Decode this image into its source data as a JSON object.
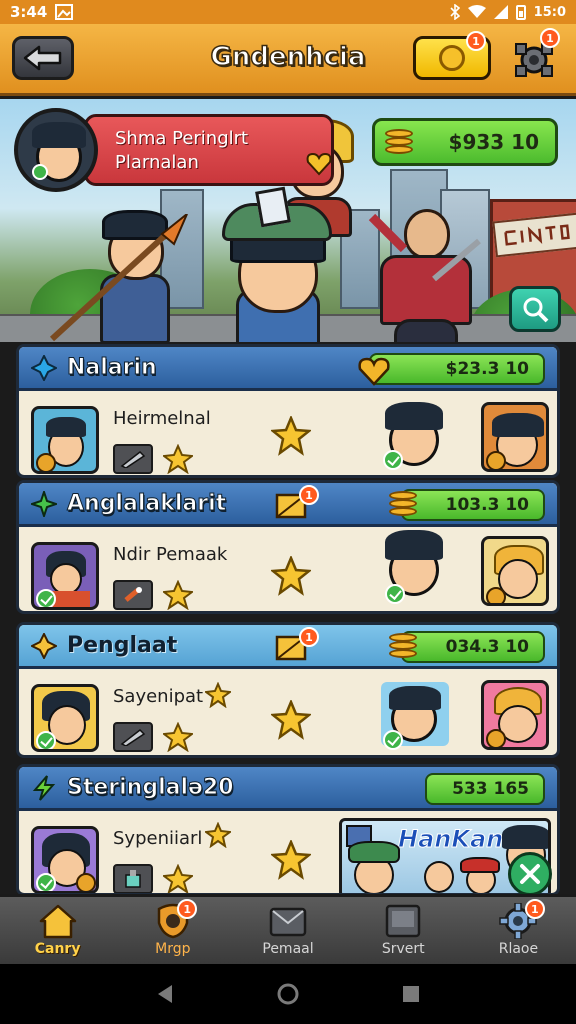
{
  "status_bar": {
    "time": "3:44",
    "right_text": "15:0"
  },
  "header": {
    "title": "Gndenhcia",
    "coin_badge": "1",
    "settings_badge": "1"
  },
  "profile": {
    "line1": "Shma Peringlrt",
    "line2": "Plarnalan"
  },
  "wallet": {
    "amount": "$933 10"
  },
  "sections": [
    {
      "title": "Nalarin",
      "amount": "$23.3 10",
      "row_name": "Heirmelnal"
    },
    {
      "title": "Anglalaklarit",
      "amount": "103.3 10",
      "row_name": "Ndir Pemaak",
      "notice_badge": "1"
    },
    {
      "title": "Penglaat",
      "amount": "034.3 10",
      "row_name": "Sayenipat",
      "notice_badge": "1"
    },
    {
      "title": "Steringlalə20",
      "amount": "533 165",
      "row_name": "Sypeniiarl",
      "promo_label": "HanKan"
    }
  ],
  "bottom_nav": [
    {
      "label": "Canry",
      "icon": "house-icon"
    },
    {
      "label": "Mrgp",
      "icon": "shield-badge-icon",
      "badge": "1"
    },
    {
      "label": "Pemaal",
      "icon": "envelope-icon"
    },
    {
      "label": "Srvert",
      "icon": "tablet-icon"
    },
    {
      "label": "Rlaoe",
      "icon": "gear-icon",
      "badge": "1"
    }
  ],
  "colors": {
    "header": "#f0a830",
    "accent_green": "#4cbb2e",
    "section_blue": "#2c5f9e",
    "badge": "#ff5a1e"
  }
}
